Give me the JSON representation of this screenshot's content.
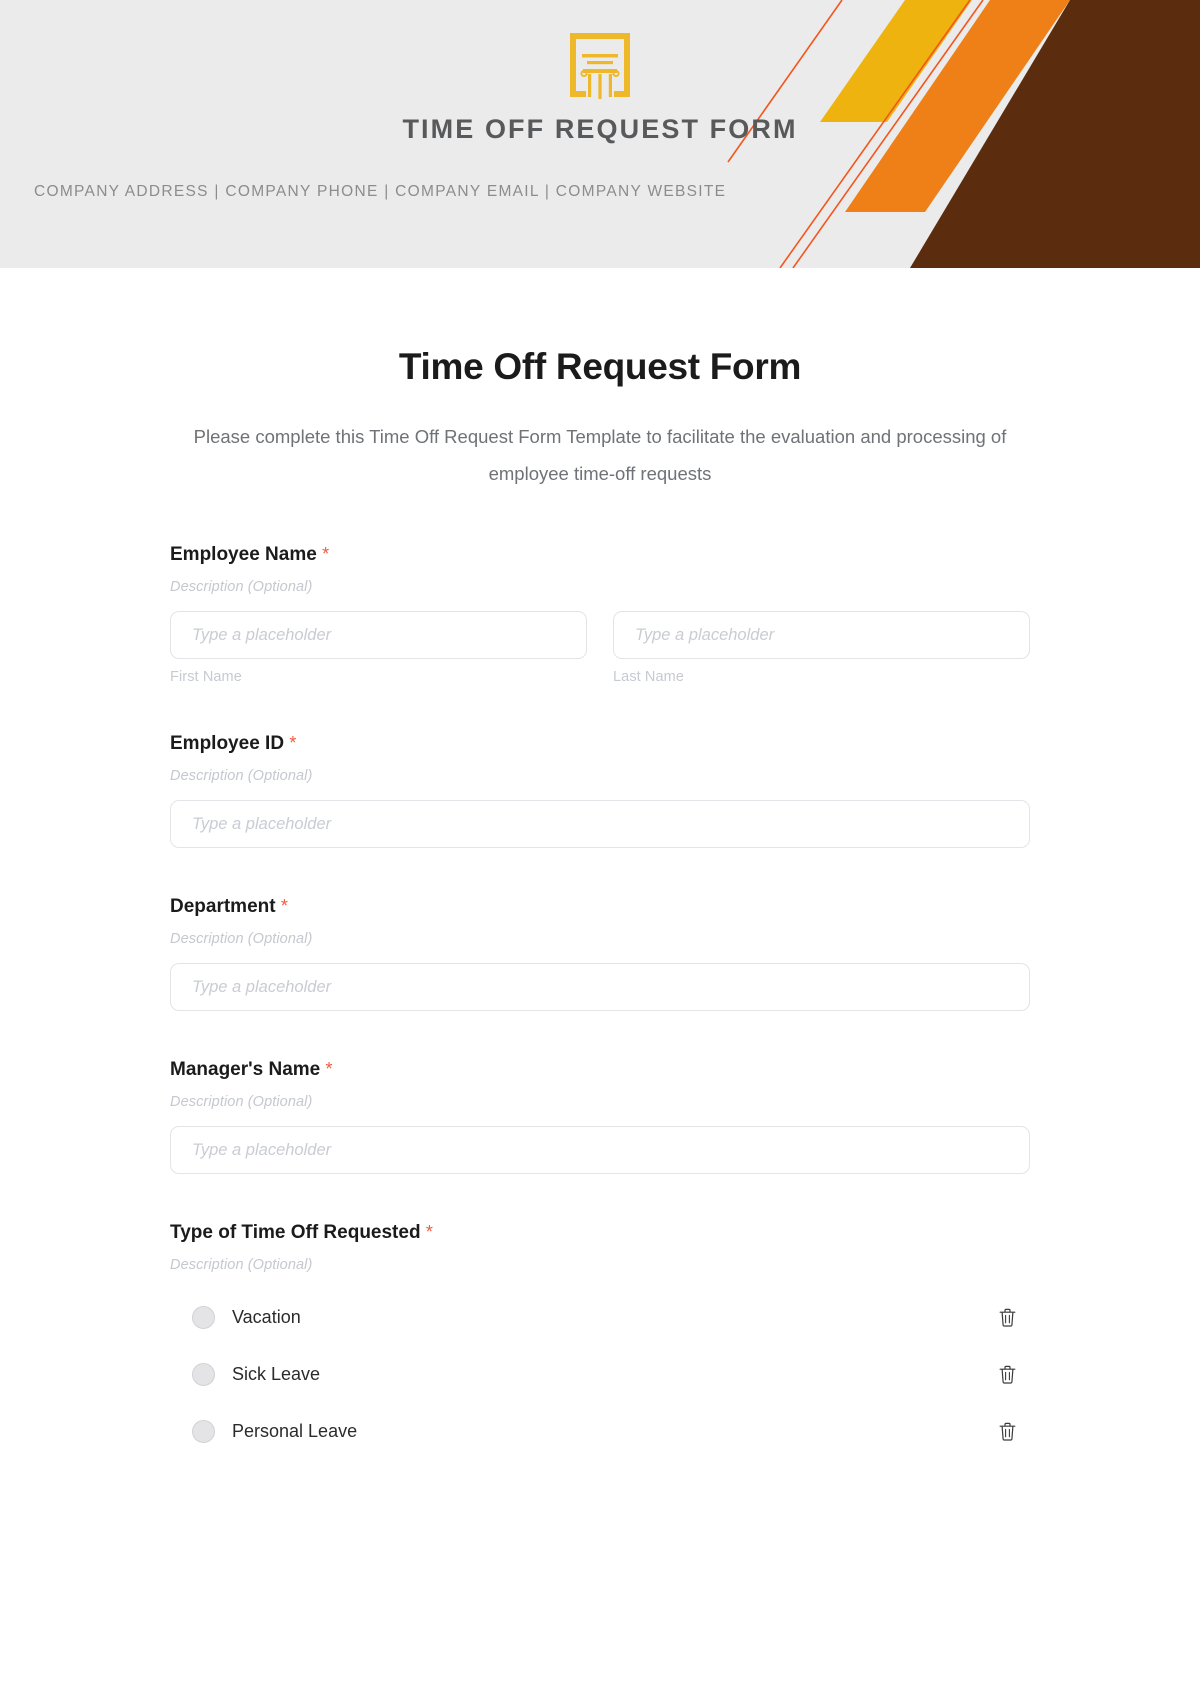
{
  "banner": {
    "logo_icon": "column-pillar-icon",
    "title": "TIME OFF REQUEST FORM",
    "contact_line": "COMPANY ADDRESS | COMPANY PHONE | COMPANY EMAIL | COMPANY WEBSITE",
    "colors": {
      "background": "#ebebeb",
      "logo": "#eeb82a",
      "dark_brown": "#5b2c0d",
      "orange": "#ef7f17",
      "gold": "#efb310",
      "thin_line": "#f2561d",
      "title_text": "#58595b",
      "contact_text": "#8a8c8e"
    }
  },
  "form": {
    "title": "Time Off Request Form",
    "subtitle": "Please complete this Time Off Request Form Template to facilitate the evaluation and processing of employee time-off requests",
    "required_marker": "*",
    "description_placeholder": "Description (Optional)",
    "input_placeholder": "Type a placeholder",
    "fields": [
      {
        "label": "Employee Name",
        "required": true,
        "description": "Description (Optional)",
        "type": "name",
        "inputs": [
          {
            "placeholder": "Type a placeholder",
            "sub_label": "First Name"
          },
          {
            "placeholder": "Type a placeholder",
            "sub_label": "Last Name"
          }
        ]
      },
      {
        "label": "Employee ID",
        "required": true,
        "description": "Description (Optional)",
        "type": "text",
        "inputs": [
          {
            "placeholder": "Type a placeholder",
            "sub_label": ""
          }
        ]
      },
      {
        "label": "Department",
        "required": true,
        "description": "Description (Optional)",
        "type": "text",
        "inputs": [
          {
            "placeholder": "Type a placeholder",
            "sub_label": ""
          }
        ]
      },
      {
        "label": "Manager's Name",
        "required": true,
        "description": "Description (Optional)",
        "type": "text",
        "inputs": [
          {
            "placeholder": "Type a placeholder",
            "sub_label": ""
          }
        ]
      },
      {
        "label": "Type of Time Off Requested",
        "required": true,
        "description": "Description (Optional)",
        "type": "radio",
        "options": [
          {
            "label": "Vacation",
            "selected": false,
            "delete_icon": "trash-icon"
          },
          {
            "label": "Sick Leave",
            "selected": false,
            "delete_icon": "trash-icon"
          },
          {
            "label": "Personal Leave",
            "selected": false,
            "delete_icon": "trash-icon"
          }
        ]
      }
    ],
    "colors": {
      "title_text": "#1b1b1b",
      "subtitle_text": "#6f7276",
      "required_star": "#f4593c",
      "placeholder": "#c9ccd3",
      "description": "#c5c8cf",
      "input_border": "#e2e4e8"
    }
  }
}
